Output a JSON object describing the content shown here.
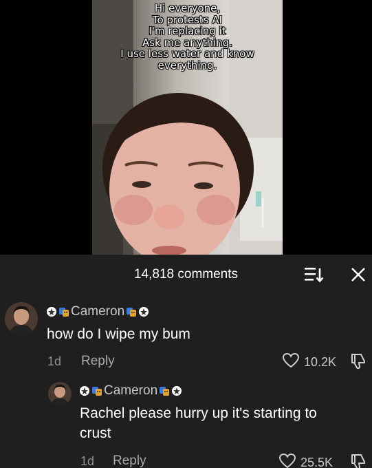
{
  "video": {
    "caption_lines": [
      "Hi everyone,",
      "To protests AI",
      "I'm replacing it",
      "Ask me anything.",
      "I use less water and know",
      "everything."
    ]
  },
  "comments_panel": {
    "count_label": "14,818 comments",
    "sort_icon": "sort-icon",
    "close_icon": "close-icon",
    "comments": [
      {
        "username": "Cameron",
        "text": "how do I wipe my bum",
        "age": "1d",
        "reply_label": "Reply",
        "likes": "10.2K"
      },
      {
        "username": "Cameron",
        "text_line1": "Rachel please hurry up it's starting to",
        "text_line2": "crust",
        "age": "1d",
        "reply_label": "Reply",
        "likes": "25.5K"
      }
    ]
  },
  "colors": {
    "panel_bg": "#1f1f1f",
    "username": "#c9c9c9",
    "meta": "#8f8f8f"
  }
}
